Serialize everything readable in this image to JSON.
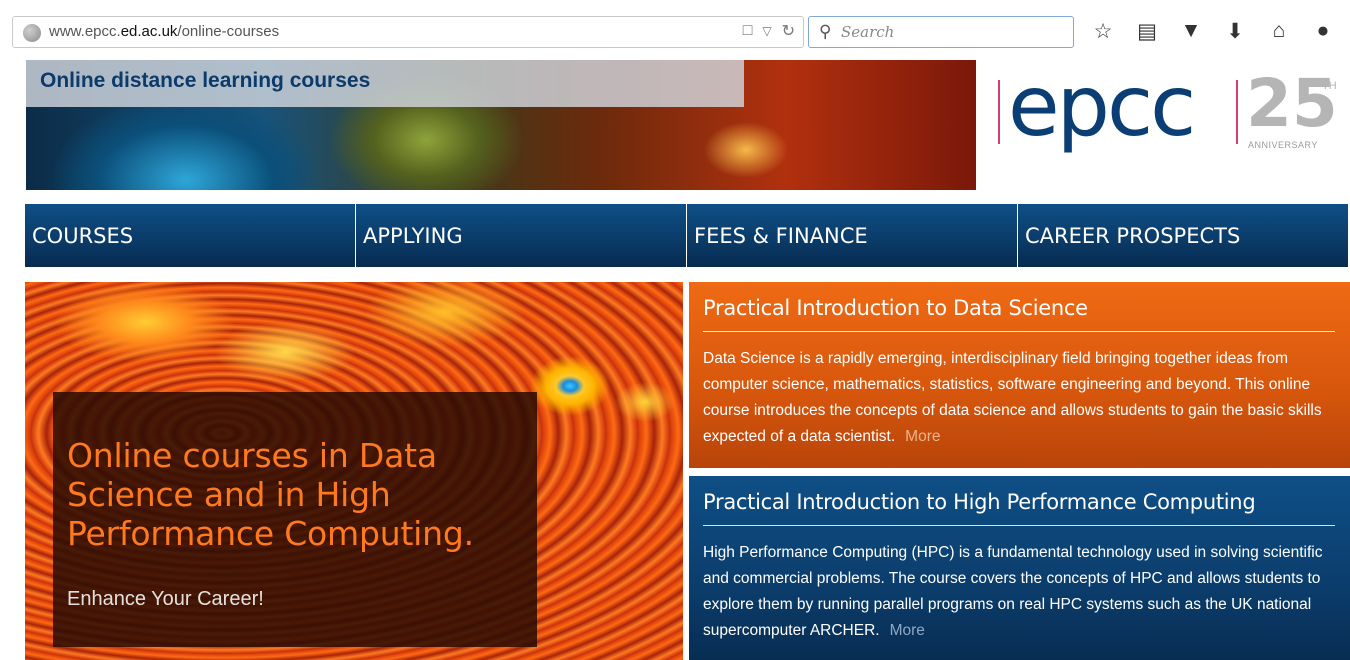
{
  "browser": {
    "url_prefix": "www.epcc.",
    "url_domain": "ed.ac.uk",
    "url_path": "/online-courses",
    "search_placeholder": "Search",
    "icons": [
      "reader-view-icon",
      "dropdown-icon",
      "reload-icon",
      "bookmark-star-icon",
      "reading-list-icon",
      "pocket-icon",
      "download-icon",
      "home-icon",
      "chat-icon"
    ]
  },
  "banner": {
    "title": "Online distance learning courses"
  },
  "logo": {
    "brand": "epcc",
    "number": "25",
    "suffix": "TH",
    "caption": "ANNIVERSARY",
    "accent_color": "#d0406a",
    "brand_color": "#0b3e75"
  },
  "nav": {
    "items": [
      {
        "label": "COURSES"
      },
      {
        "label": "APPLYING"
      },
      {
        "label": "FEES & FINANCE"
      },
      {
        "label": "CAREER PROSPECTS"
      }
    ]
  },
  "hero": {
    "heading": "Online courses in Data Science and in High Performance Computing.",
    "subheading": "Enhance Your Career!"
  },
  "panels": {
    "data_science": {
      "title": "Practical Introduction to Data Science",
      "body": "Data Science is a rapidly emerging, interdisciplinary field bringing together ideas from computer science, mathematics, statistics, software engineering and beyond. This online course introduces the concepts of data science and allows students to gain the basic skills expected of a data scientist.",
      "more": "More",
      "color": "#e0600f"
    },
    "hpc": {
      "title": "Practical Introduction to High Performance Computing",
      "body": "High Performance Computing (HPC) is a fundamental technology used in solving scientific and commercial problems. The course covers the concepts of HPC and allows students to explore them by running parallel programs on real HPC systems such as the UK national supercomputer ARCHER.",
      "more": "More",
      "color": "#0b3d6c"
    }
  }
}
